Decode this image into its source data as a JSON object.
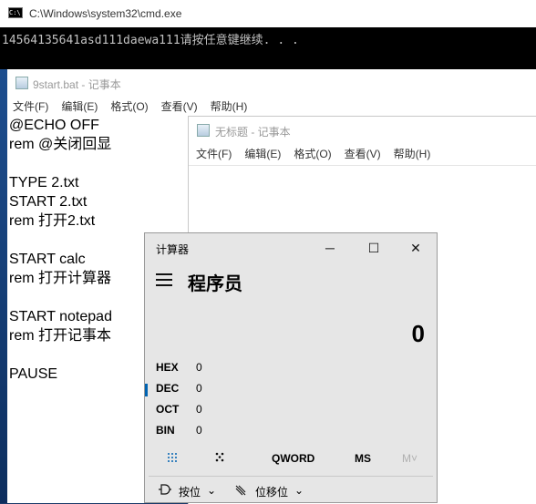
{
  "cmd": {
    "title": "C:\\Windows\\system32\\cmd.exe",
    "icon": "cmd-icon",
    "output": "14564135641asd111daewa111请按任意键继续. . ."
  },
  "notepad_main": {
    "title": "9start.bat - 记事本",
    "menu": [
      "文件(F)",
      "编辑(E)",
      "格式(O)",
      "查看(V)",
      "帮助(H)"
    ],
    "content": "@ECHO OFF\nrem @关闭回显\n\nTYPE 2.txt\nSTART 2.txt\nrem 打开2.txt\n\nSTART calc\nrem 打开计算器\n\nSTART notepad\nrem 打开记事本\n\nPAUSE"
  },
  "notepad_untitled": {
    "title": "无标题 - 记事本",
    "menu": [
      "文件(F)",
      "编辑(E)",
      "格式(O)",
      "查看(V)",
      "帮助(H)"
    ]
  },
  "calculator": {
    "title": "计算器",
    "mode": "程序员",
    "display": "0",
    "radix": [
      {
        "key": "HEX",
        "value": "0"
      },
      {
        "key": "DEC",
        "value": "0"
      },
      {
        "key": "OCT",
        "value": "0"
      },
      {
        "key": "BIN",
        "value": "0"
      }
    ],
    "selected_radix": "DEC",
    "tabs": {
      "word_size": "QWORD",
      "memory_store": "MS",
      "memory_list": "M˅"
    },
    "tools": {
      "bitwise": "按位",
      "bit_shift": "位移位"
    },
    "accent": "#0063b1"
  }
}
